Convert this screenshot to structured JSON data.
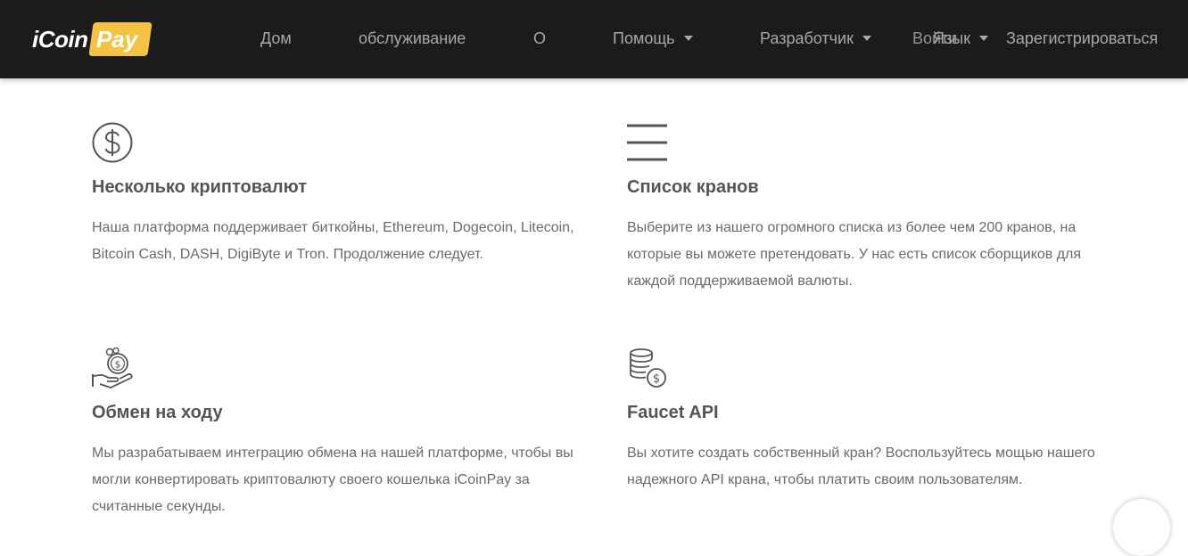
{
  "brand": {
    "logo_text_main": "iCoin",
    "logo_text_pay": "Pay"
  },
  "nav": {
    "home": "Дом",
    "services": "обслуживание",
    "about": "О",
    "help": "Помощь",
    "developer": "Разработчик",
    "language": "Язык",
    "login": "Войти",
    "register": "Зарегистрироваться"
  },
  "features": [
    {
      "icon": "dollar-circle-icon",
      "title": "Несколько криптовалют",
      "text": "Наша платформа поддерживает биткойны, Ethereum, Dogecoin, Litecoin, Bitcoin Cash, DASH, DigiByte и Tron. Продолжение следует."
    },
    {
      "icon": "list-icon",
      "title": "Список кранов",
      "text": "Выберите из нашего огромного списка из более чем 200 кранов, на которые вы можете претендовать. У нас есть список сборщиков для каждой поддерживаемой валюты."
    },
    {
      "icon": "hand-coins-icon",
      "title": "Обмен на ходу",
      "text": "Мы разрабатываем интеграцию обмена на нашей платформе, чтобы вы могли конвертировать криптовалюту своего кошелька iCoinPay за считанные секунды."
    },
    {
      "icon": "coin-stack-icon",
      "title": "Faucet API",
      "text": "Вы хотите создать собственный кран? Воспользуйтесь мощью нашего надежного API крана, чтобы платить своим пользователям."
    }
  ],
  "colors": {
    "navbar_bg": "#1b1b1b",
    "brand_yellow": "#f5c242",
    "nav_text": "#a8a8a8",
    "heading": "#555555",
    "body_text": "#6a6a6a"
  }
}
